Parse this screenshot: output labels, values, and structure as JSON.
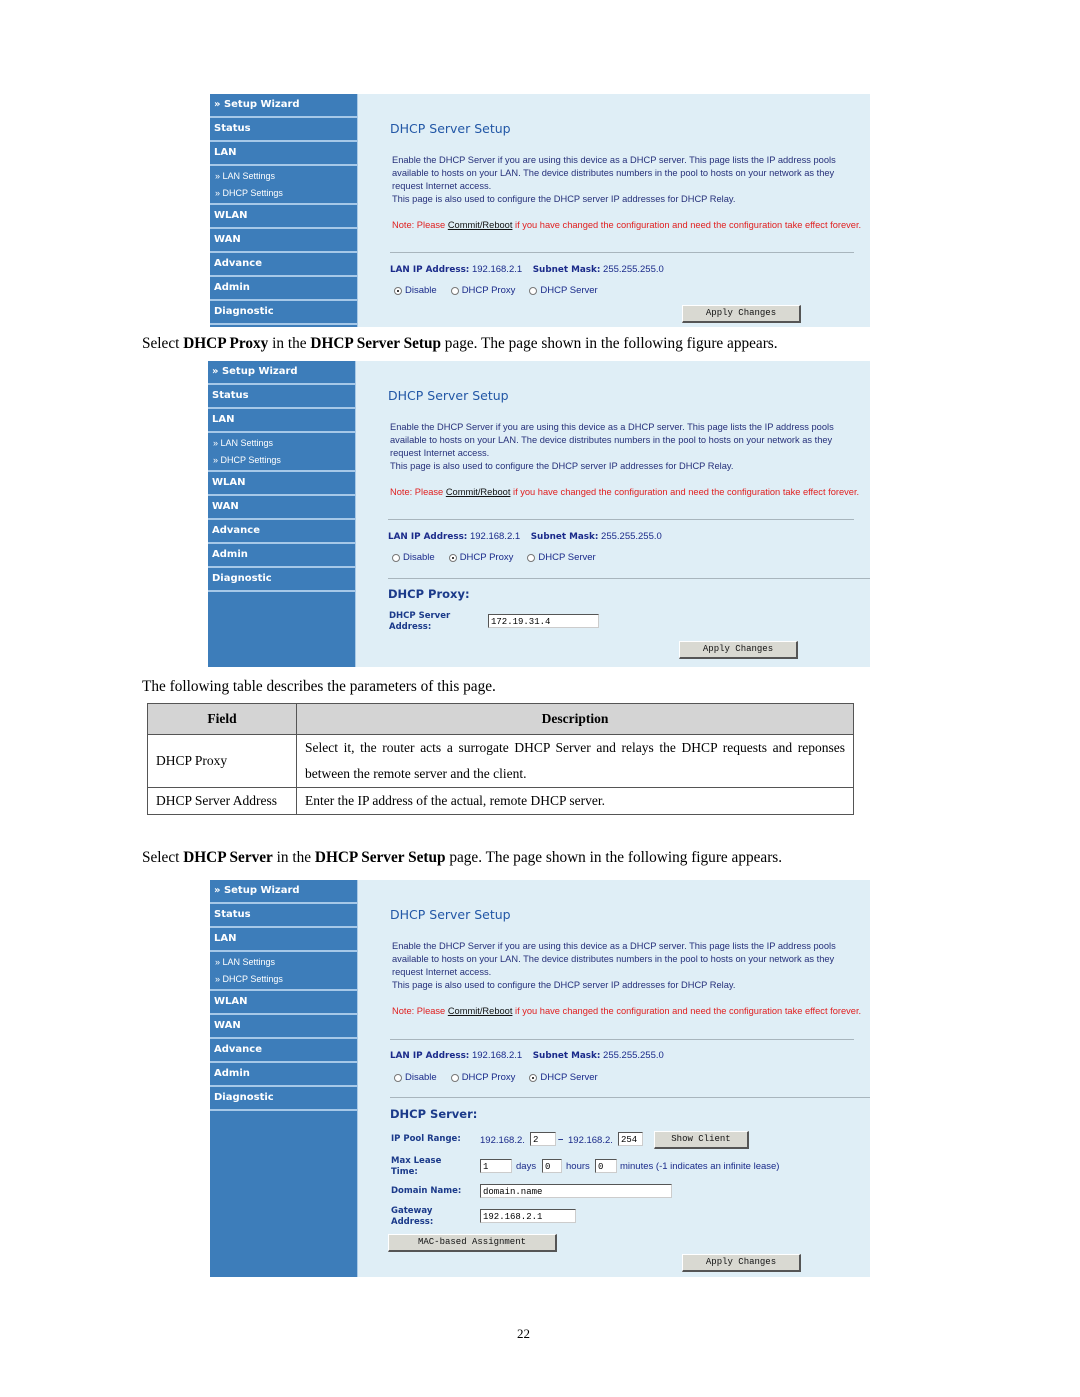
{
  "screens": [
    {
      "nav": {
        "setup_wizard": "» Setup Wizard",
        "status": "Status",
        "lan": "LAN",
        "lan_settings": "» LAN Settings",
        "dhcp_settings": "» DHCP Settings",
        "wlan": "WLAN",
        "wan": "WAN",
        "advance": "Advance",
        "admin": "Admin",
        "diagnostic": "Diagnostic"
      },
      "title": "DHCP Server Setup",
      "description": "Enable the DHCP Server if you are using this device as a DHCP server. This page lists the IP address pools available to hosts on your LAN. The device distributes numbers in the pool to hosts on your network as they request Internet access.",
      "description2": "This page is also used to configure the DHCP server IP addresses for DHCP Relay.",
      "note_prefix": "Note: Please ",
      "note_link": "Commit/Reboot",
      "note_suffix": " if you have changed the configuration and need the configuration take effect forever.",
      "lan_ip_label": "LAN IP Address:",
      "lan_ip": "192.168.2.1",
      "subnet_label": "Subnet Mask:",
      "subnet": "255.255.255.0",
      "radio_disable": "Disable",
      "radio_proxy": "DHCP Proxy",
      "radio_server": "DHCP Server",
      "selected_mode": "Disable",
      "apply": "Apply Changes"
    },
    {
      "selected_mode": "DHCP Proxy",
      "proxy_section": "DHCP Proxy:",
      "proxy_server_label": "DHCP Server Address:",
      "proxy_server_value": "172.19.31.4",
      "apply": "Apply Changes"
    },
    {
      "selected_mode": "DHCP Server",
      "server_section": "DHCP Server:",
      "pool_label": "IP Pool Range:",
      "pool_prefix": "192.168.2.",
      "pool_start": "2",
      "pool_dash": "–",
      "pool_end": "254",
      "show_client": "Show Client",
      "lease_label": "Max Lease Time:",
      "lease_days": "1",
      "lease_days_unit": "days",
      "lease_hours": "0",
      "lease_hours_unit": "hours",
      "lease_minutes": "0",
      "lease_minutes_unit": "minutes (-1 indicates an infinite lease)",
      "domain_label": "Domain Name:",
      "domain_value": "domain.name",
      "gateway_label": "Gateway Address:",
      "gateway_value": "192.168.2.1",
      "mac_button": "MAC-based Assignment",
      "apply": "Apply Changes"
    }
  ],
  "doc": {
    "para1": {
      "a": "Select ",
      "b": "DHCP Proxy",
      "c": " in the ",
      "d": "DHCP Server Setup",
      "e": " page. The page shown in the following figure appears."
    },
    "para2": "The following table describes the parameters of this page.",
    "table": {
      "headers": [
        "Field",
        "Description"
      ],
      "rows": [
        {
          "field": "DHCP Proxy",
          "description": "Select it, the router acts a surrogate DHCP Server and relays the DHCP requests and reponses between the remote server and the client."
        },
        {
          "field": "DHCP Server Address",
          "description": "Enter the IP address of the actual, remote DHCP server."
        }
      ]
    },
    "para3": {
      "a": "Select ",
      "b": "DHCP Server",
      "c": " in the ",
      "d": "DHCP Server Setup",
      "e": " page. The page shown in the following figure appears."
    },
    "page_number": "22"
  }
}
